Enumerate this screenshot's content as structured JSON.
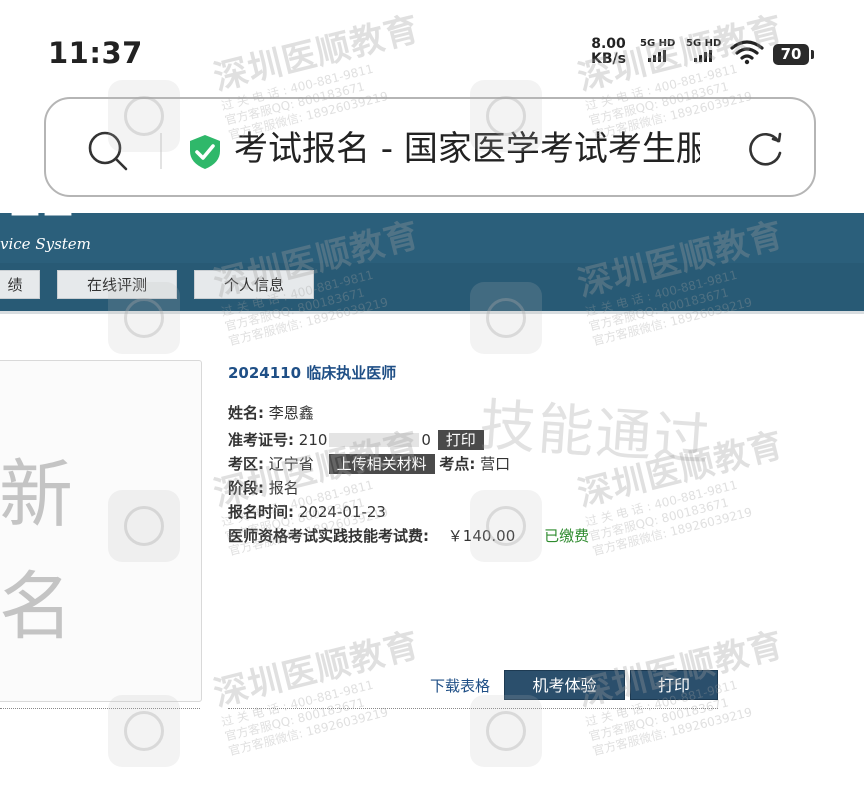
{
  "status_bar": {
    "time": "11:37",
    "net_speed_value": "8.00",
    "net_speed_unit": "KB/s",
    "sim1_label": "5G HD",
    "sim2_label": "5G HD",
    "battery_level": "70"
  },
  "browser": {
    "address_text": "考试报名 - 国家医学考试考生服务"
  },
  "site": {
    "subtitle": "vice System",
    "nav_items": [
      "绩",
      "在线评测",
      "个人信息"
    ]
  },
  "photo": {
    "line1": "新",
    "line2": "名"
  },
  "exam": {
    "title": "2024110 临床执业医师",
    "name_label": "姓名:",
    "name_value": "李恩鑫",
    "ticket_label": "准考证号:",
    "ticket_prefix": "210",
    "ticket_suffix": "0",
    "print_label": "打印",
    "region_label": "考区:",
    "region_value": "辽宁省",
    "upload_label": "上传相关材料",
    "site_label": "考点:",
    "site_value": "营口",
    "stage_label": "阶段:",
    "stage_value": "报名",
    "date_label": "报名时间:",
    "date_value": "2024-01-23",
    "fee_label": "医师资格考试实践技能考试费:",
    "fee_value": "￥140.00",
    "fee_status": "已缴费"
  },
  "actions": {
    "download_label": "下载表格",
    "machine_test_label": "机考体验",
    "print_label": "打印"
  },
  "watermark": {
    "brand": "深圳医顺教育",
    "phone": "过 关 电 话 : 400-881-9811",
    "qq": "官方客服QQ: 800183671",
    "wechat": "官方客服微信: 18926039219",
    "skill_text": "技能通过"
  },
  "colors": {
    "header_blue": "#2b5f7b",
    "nav_blue": "#285a75",
    "title_blue": "#1f4f86",
    "button_dark": "#2b4f6c",
    "paid_green": "#2e8b2e",
    "shield_green": "#2fb86a"
  },
  "icons": {
    "search": "search-icon",
    "shield": "shield-check-icon",
    "reload": "reload-icon",
    "wifi": "wifi-icon"
  }
}
